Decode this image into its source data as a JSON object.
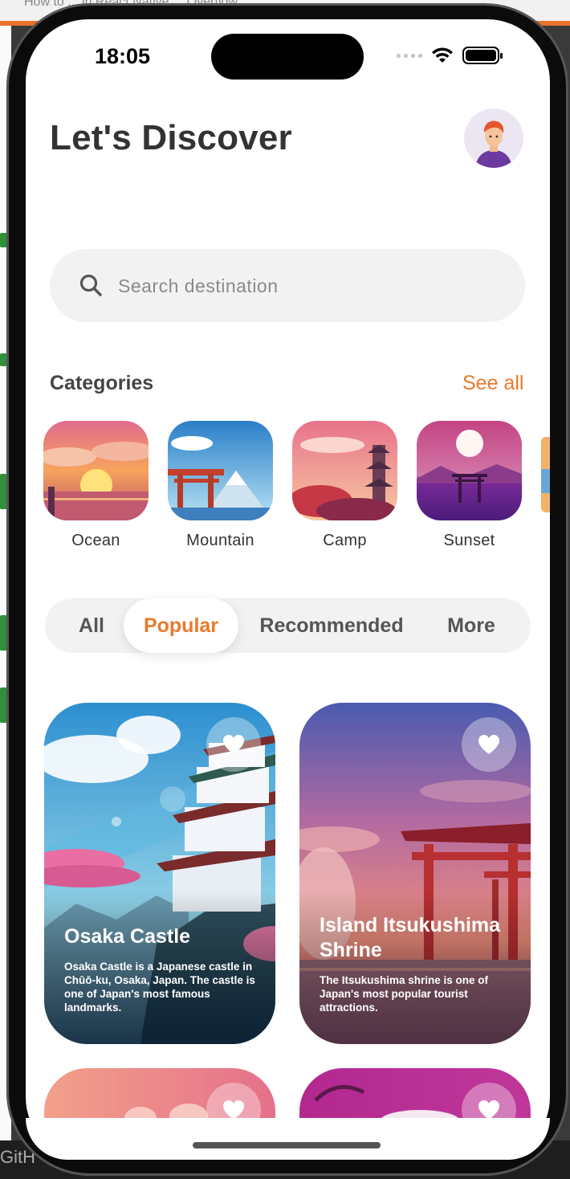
{
  "status": {
    "time": "18:05"
  },
  "header": {
    "title": "Let's Discover"
  },
  "search": {
    "placeholder": "Search destination"
  },
  "categories": {
    "heading": "Categories",
    "see_all": "See all",
    "items": [
      {
        "label": "Ocean"
      },
      {
        "label": "Mountain"
      },
      {
        "label": "Camp"
      },
      {
        "label": "Sunset"
      }
    ]
  },
  "tabs": [
    {
      "label": "All"
    },
    {
      "label": "Popular",
      "active": true
    },
    {
      "label": "Recommended"
    },
    {
      "label": "More"
    }
  ],
  "cards": [
    {
      "title": "Osaka Castle",
      "description": "Osaka Castle is a Japanese castle in Chūō-ku, Osaka, Japan. The castle is one of Japan's most famous landmarks."
    },
    {
      "title": "Island Itsukushima Shrine",
      "description": "The Itsukushima shrine is one of Japan's most popular tourist attractions."
    }
  ],
  "colors": {
    "accent": "#ea7a2c",
    "text": "#333333",
    "search_bg": "#f2f2f2"
  },
  "background": {
    "window_title": "How to ... in React Native ... Overflow",
    "bottom_text": "GitH"
  }
}
